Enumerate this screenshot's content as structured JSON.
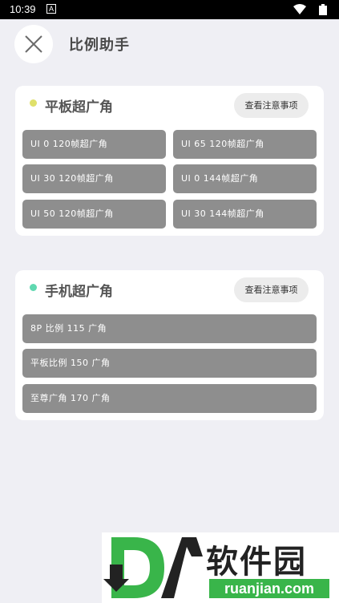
{
  "status_bar": {
    "time": "10:39",
    "notification_icon": "a-box-icon"
  },
  "header": {
    "title": "比例助手",
    "close_icon": "close-icon"
  },
  "tablet_section": {
    "title": "平板超广角",
    "dot_color": "#dfe06a",
    "notice_label": "查看注意事项",
    "options": [
      "UI 0 120帧超广角",
      "UI 65 120帧超广角",
      "UI 30 120帧超广角",
      "UI 0 144帧超广角",
      "UI 50 120帧超广角",
      "UI 30 144帧超广角"
    ]
  },
  "phone_section": {
    "title": "手机超广角",
    "dot_color": "#5fd8b0",
    "notice_label": "查看注意事项",
    "options": [
      "8P 比例 115 广角",
      "平板比例 150 广角",
      "至尊广角 170 广角"
    ]
  },
  "watermark": {
    "cn_text": "软件园",
    "url_text": "ruanjian.com",
    "brand_color": "#39b54a"
  }
}
